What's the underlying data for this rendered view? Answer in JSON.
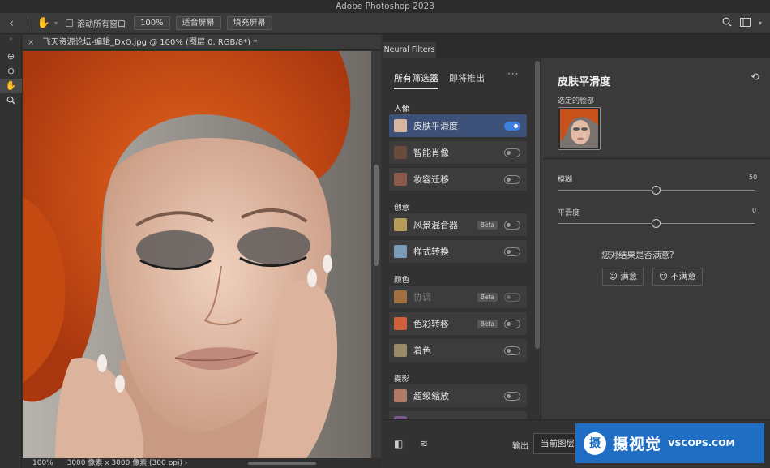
{
  "app": {
    "title": "Adobe Photoshop 2023"
  },
  "options_bar": {
    "scroll_all_label": "滚动所有窗口",
    "zoom_100": "100%",
    "fit_screen": "适合屏幕",
    "fill_screen": "填充屏幕"
  },
  "document": {
    "tab_title": "飞天资源论坛-编辑_DxO.jpg @ 100% (图层 0, RGB/8*) *",
    "zoom": "100%",
    "size_info": "3000 像素 x 3000 像素 (300 ppi)"
  },
  "neural_filters": {
    "panel_tab": "Neural Filters",
    "tabs": [
      "所有筛选器",
      "即将推出"
    ],
    "more": "···",
    "categories": [
      "人像",
      "创意",
      "颜色",
      "摄影"
    ],
    "filters": [
      {
        "name": "皮肤平滑度",
        "on": true
      },
      {
        "name": "智能肖像",
        "on": false
      },
      {
        "name": "妆容迁移",
        "on": false
      },
      {
        "name": "风景混合器",
        "badge": "Beta",
        "on": false
      },
      {
        "name": "样式转换",
        "on": false
      },
      {
        "name": "协调",
        "badge": "Beta",
        "on": false
      },
      {
        "name": "色彩转移",
        "badge": "Beta",
        "on": false
      },
      {
        "name": "着色",
        "on": false
      },
      {
        "name": "超级缩放",
        "on": false
      }
    ],
    "settings": {
      "title": "皮肤平滑度",
      "selected_face_label": "选定的脸部",
      "blur_label": "模糊",
      "blur_value": "50",
      "smooth_label": "平滑度",
      "smooth_value": "0",
      "satisfaction_q": "您对结果是否满意?",
      "yes": "满意",
      "no": "不满意"
    },
    "output_label": "输出",
    "output_value": "当前图层"
  },
  "watermark": {
    "logo_char": "摄",
    "brand": "摄视觉",
    "site": "VSCOPS.COM"
  }
}
